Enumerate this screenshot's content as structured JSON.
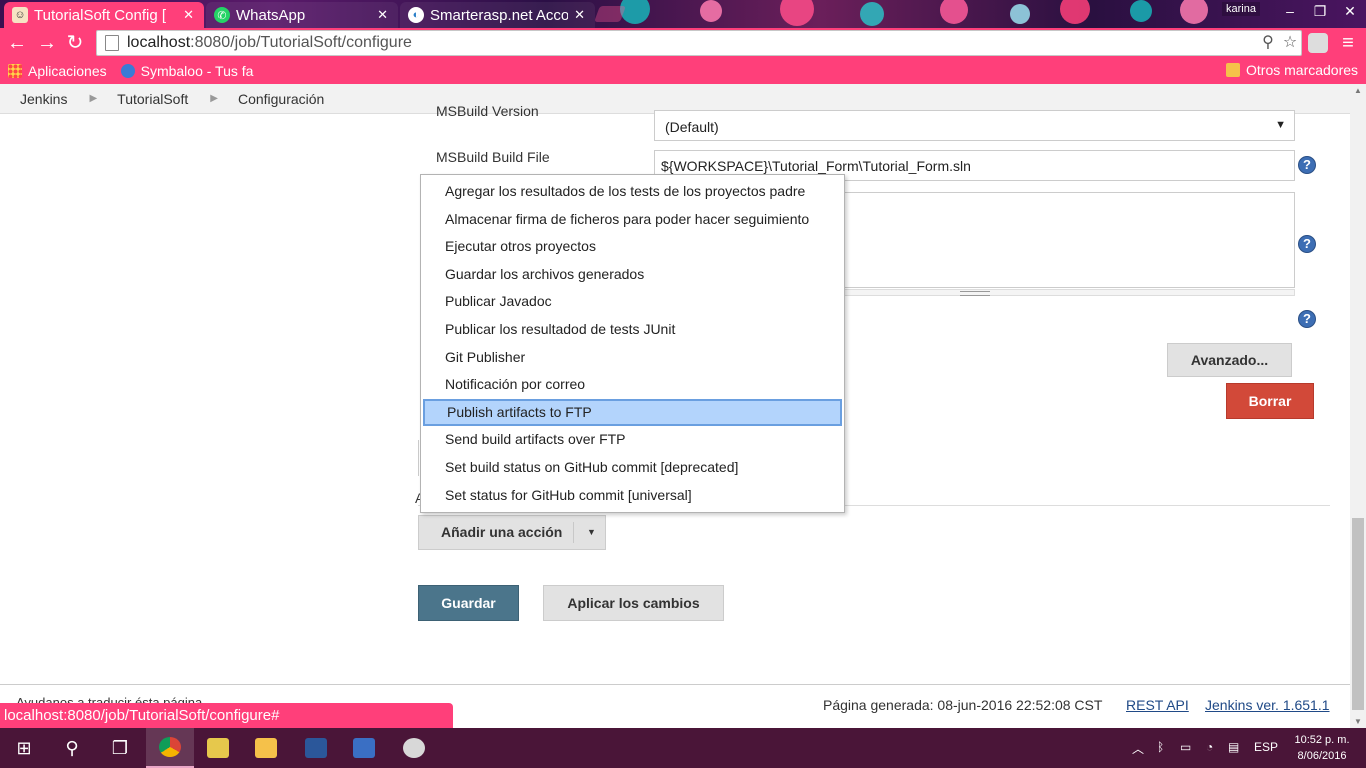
{
  "browser": {
    "tabs": [
      {
        "title": "TutorialSoft Config [",
        "active": true
      },
      {
        "title": "WhatsApp",
        "active": false
      },
      {
        "title": "Smarterasp.net Acco",
        "active": false
      }
    ],
    "profile_name": "karina",
    "url_host": "localhost",
    "url_path": ":8080/job/TutorialSoft/configure",
    "bookmarks": {
      "apps": "Aplicaciones",
      "symbaloo": "Symbaloo - Tus fa",
      "other": "Otros marcadores"
    },
    "status_url": "localhost:8080/job/TutorialSoft/configure#"
  },
  "breadcrumb": [
    "Jenkins",
    "TutorialSoft",
    "Configuración"
  ],
  "form": {
    "msbuild_version_label": "MSBuild Version",
    "msbuild_version_value": "(Default)",
    "msbuild_file_label": "MSBuild Build File",
    "msbuild_file_value": "${WORKSPACE}\\Tutorial_Form\\Tutorial_Form.sln",
    "help_glyph": "?",
    "avanzado": "Avanzado...",
    "borrar": "Borrar",
    "add_action": "Añadir una acción",
    "guardar": "Guardar",
    "aplicar": "Aplicar los cambios",
    "covered_letter": "A"
  },
  "dropdown": {
    "items": [
      "Agregar los resultados de los tests de los proyectos padre",
      "Almacenar firma de ficheros para poder hacer seguimiento",
      "Ejecutar otros proyectos",
      "Guardar los archivos generados",
      "Publicar Javadoc",
      "Publicar los resultadod de tests JUnit",
      "Git Publisher",
      "Notificación por correo",
      "Publish artifacts to FTP",
      "Send build artifacts over FTP",
      "Set build status on GitHub commit [deprecated]",
      "Set status for GitHub commit [universal]"
    ],
    "highlighted_index": 8
  },
  "footer": {
    "translate": "Ayudanos a traducir ésta página",
    "generated": "Página generada: 08-jun-2016 22:52:08 CST",
    "rest_api": "REST API",
    "version": "Jenkins ver. 1.651.1"
  },
  "taskbar": {
    "language": "ESP",
    "time": "10:52 p. m.",
    "date": "8/06/2016"
  },
  "colors": {
    "browser_accent": "#ff3f7a",
    "jenkins_save": "#4b758b",
    "jenkins_delete": "#d24939",
    "highlight": "#b3d4fc"
  }
}
